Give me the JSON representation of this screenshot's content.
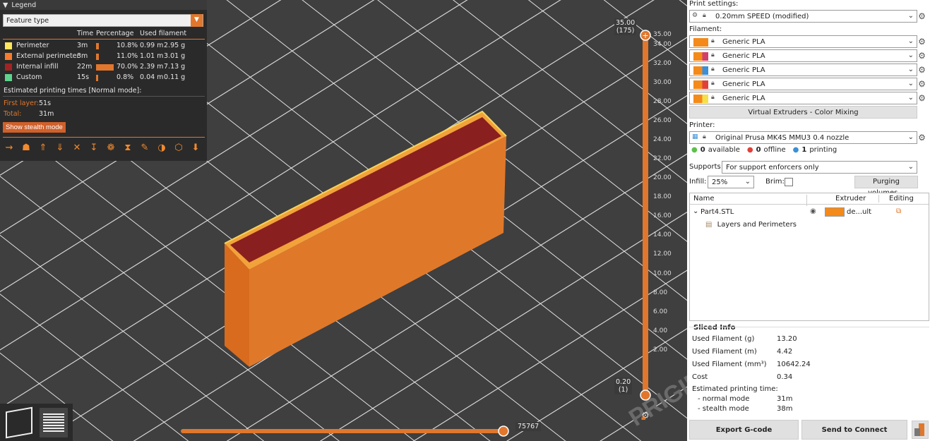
{
  "legend": {
    "title": "Legend",
    "feature_type": "Feature type",
    "col_time": "Time",
    "col_pct": "Percentage",
    "col_fil": "Used filament",
    "rows": [
      {
        "name": "Perimeter",
        "time": "3m",
        "pct": "10.8%",
        "m": "0.99 m",
        "g": "2.95 g",
        "color": "#ffe65c",
        "frac": 0.108
      },
      {
        "name": "External perimeter",
        "time": "3m",
        "pct": "11.0%",
        "m": "1.01 m",
        "g": "3.01 g",
        "color": "#f47c2c",
        "frac": 0.11
      },
      {
        "name": "Internal infill",
        "time": "22m",
        "pct": "70.0%",
        "m": "2.39 m",
        "g": "7.13 g",
        "color": "#a12424",
        "frac": 0.7
      },
      {
        "name": "Custom",
        "time": "15s",
        "pct": "0.8%",
        "m": "0.04 m",
        "g": "0.11 g",
        "color": "#5fd38d",
        "frac": 0.008
      }
    ],
    "est_title": "Estimated printing times [Normal mode]:",
    "first_layer_label": "First layer:",
    "first_layer_val": "51s",
    "total_label": "Total:",
    "total_val": "31m",
    "stealth_btn": "Show stealth mode"
  },
  "vslider": {
    "top_val": "35.00",
    "top_layer": "(175)",
    "bottom_val": "0.20",
    "bottom_layer": "(1)",
    "ticks": [
      "35.00",
      "34.00",
      "32.00",
      "30.00",
      "28.00",
      "26.00",
      "24.00",
      "22.00",
      "20.00",
      "18.00",
      "16.00",
      "14.00",
      "12.00",
      "10.00",
      "8.00",
      "6.00",
      "4.00",
      "2.00"
    ]
  },
  "hslider": {
    "value": "75767"
  },
  "watermark": "PRIGIN",
  "panel": {
    "print_settings_label": "Print settings:",
    "print_profile": "0.20mm SPEED (modified)",
    "filament_label": "Filament:",
    "filaments": [
      {
        "name": "Generic PLA",
        "c1": "#f48a1a",
        "c2": "#f48a1a"
      },
      {
        "name": "Generic PLA",
        "c1": "#f48a1a",
        "c2": "#d0406a"
      },
      {
        "name": "Generic PLA",
        "c1": "#f48a1a",
        "c2": "#3a8fd6"
      },
      {
        "name": "Generic PLA",
        "c1": "#f48a1a",
        "c2": "#e0403a"
      },
      {
        "name": "Generic PLA",
        "c1": "#f48a1a",
        "c2": "#f4e04a"
      }
    ],
    "virtual_btn": "Virtual Extruders - Color Mixing",
    "printer_label": "Printer:",
    "printer": "Original Prusa MK4S MMU3 0.4 nozzle",
    "status_available": "0",
    "status_available_lbl": "available",
    "status_offline": "0",
    "status_offline_lbl": "offline",
    "status_printing": "1",
    "status_printing_lbl": "printing",
    "supports_label": "Supports:",
    "supports_val": "For support enforcers only",
    "infill_label": "Infill:",
    "infill_val": "25%",
    "brim_label": "Brim:",
    "purge_btn": "Purging volumes...",
    "col_name": "Name",
    "col_extruder": "Extruder",
    "col_editing": "Editing",
    "object_name": "Part4.STL",
    "extruder_val": "de...ult",
    "sub_item": "Layers and Perimeters",
    "sliced_title": "Sliced Info",
    "sliced": [
      {
        "k": "Used Filament (g)",
        "v": "13.20"
      },
      {
        "k": "Used Filament (m)",
        "v": "4.42"
      },
      {
        "k": "Used Filament (mm³)",
        "v": "10642.24"
      },
      {
        "k": "Cost",
        "v": "0.34"
      }
    ],
    "est_time_label": "Estimated printing time:",
    "normal_label": "- normal mode",
    "normal_val": "31m",
    "stealth_label": "- stealth mode",
    "stealth_val": "38m",
    "export_btn": "Export G-code",
    "connect_btn": "Send to Connect"
  }
}
